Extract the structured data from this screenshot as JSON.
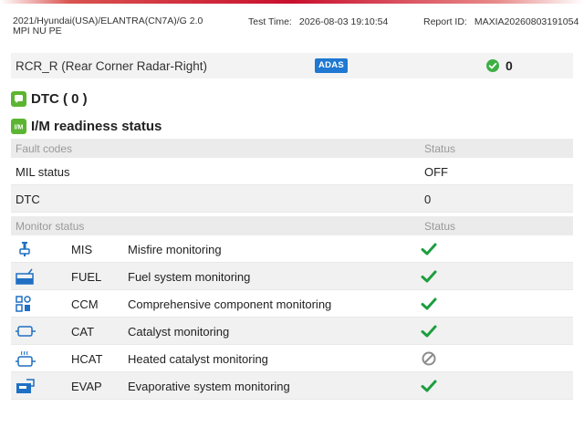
{
  "header": {
    "vehicle_line1": "2021/Hyundai(USA)/ELANTRA(CN7A)/G 2.0",
    "vehicle_line2": "MPI NU PE",
    "test_time_label": "Test Time:",
    "test_time": "2026-08-03 19:10:54",
    "report_id_label": "Report ID:",
    "report_id": "MAXIA20260803191054"
  },
  "module": {
    "name": "RCR_R (Rear Corner Radar-Right)",
    "badge": "ADAS",
    "dtc_count": "0",
    "status_icon": "check-circle-icon",
    "status_color": "#3cb043"
  },
  "dtc_section": {
    "title": "DTC ( 0 )",
    "icon": "chat-bubble-icon"
  },
  "im_section": {
    "title": "I/M readiness status",
    "icon": "im-icon",
    "icon_text": "I/M"
  },
  "fault_table": {
    "col1": "Fault codes",
    "col2": "Status",
    "rows": [
      {
        "label": "MIL status",
        "status": "OFF"
      },
      {
        "label": "DTC",
        "status": "0"
      }
    ]
  },
  "monitor_table": {
    "col1": "Monitor status",
    "col2": "Status",
    "rows": [
      {
        "icon": "misfire-icon",
        "code": "MIS",
        "desc": "Misfire monitoring",
        "status": "complete"
      },
      {
        "icon": "fuel-system-icon",
        "code": "FUEL",
        "desc": "Fuel system monitoring",
        "status": "complete"
      },
      {
        "icon": "component-icon",
        "code": "CCM",
        "desc": "Comprehensive component monitoring",
        "status": "complete"
      },
      {
        "icon": "catalyst-icon",
        "code": "CAT",
        "desc": "Catalyst monitoring",
        "status": "complete"
      },
      {
        "icon": "heated-catalyst-icon",
        "code": "HCAT",
        "desc": "Heated catalyst monitoring",
        "status": "not-supported"
      },
      {
        "icon": "evap-icon",
        "code": "EVAP",
        "desc": "Evaporative system monitoring",
        "status": "complete"
      }
    ]
  },
  "colors": {
    "accent_red": "#c8102e",
    "adas_blue": "#1f78d1",
    "check_green": "#1e9e3e",
    "icon_blue": "#1f6fc4",
    "green_icon": "#5cb531"
  }
}
